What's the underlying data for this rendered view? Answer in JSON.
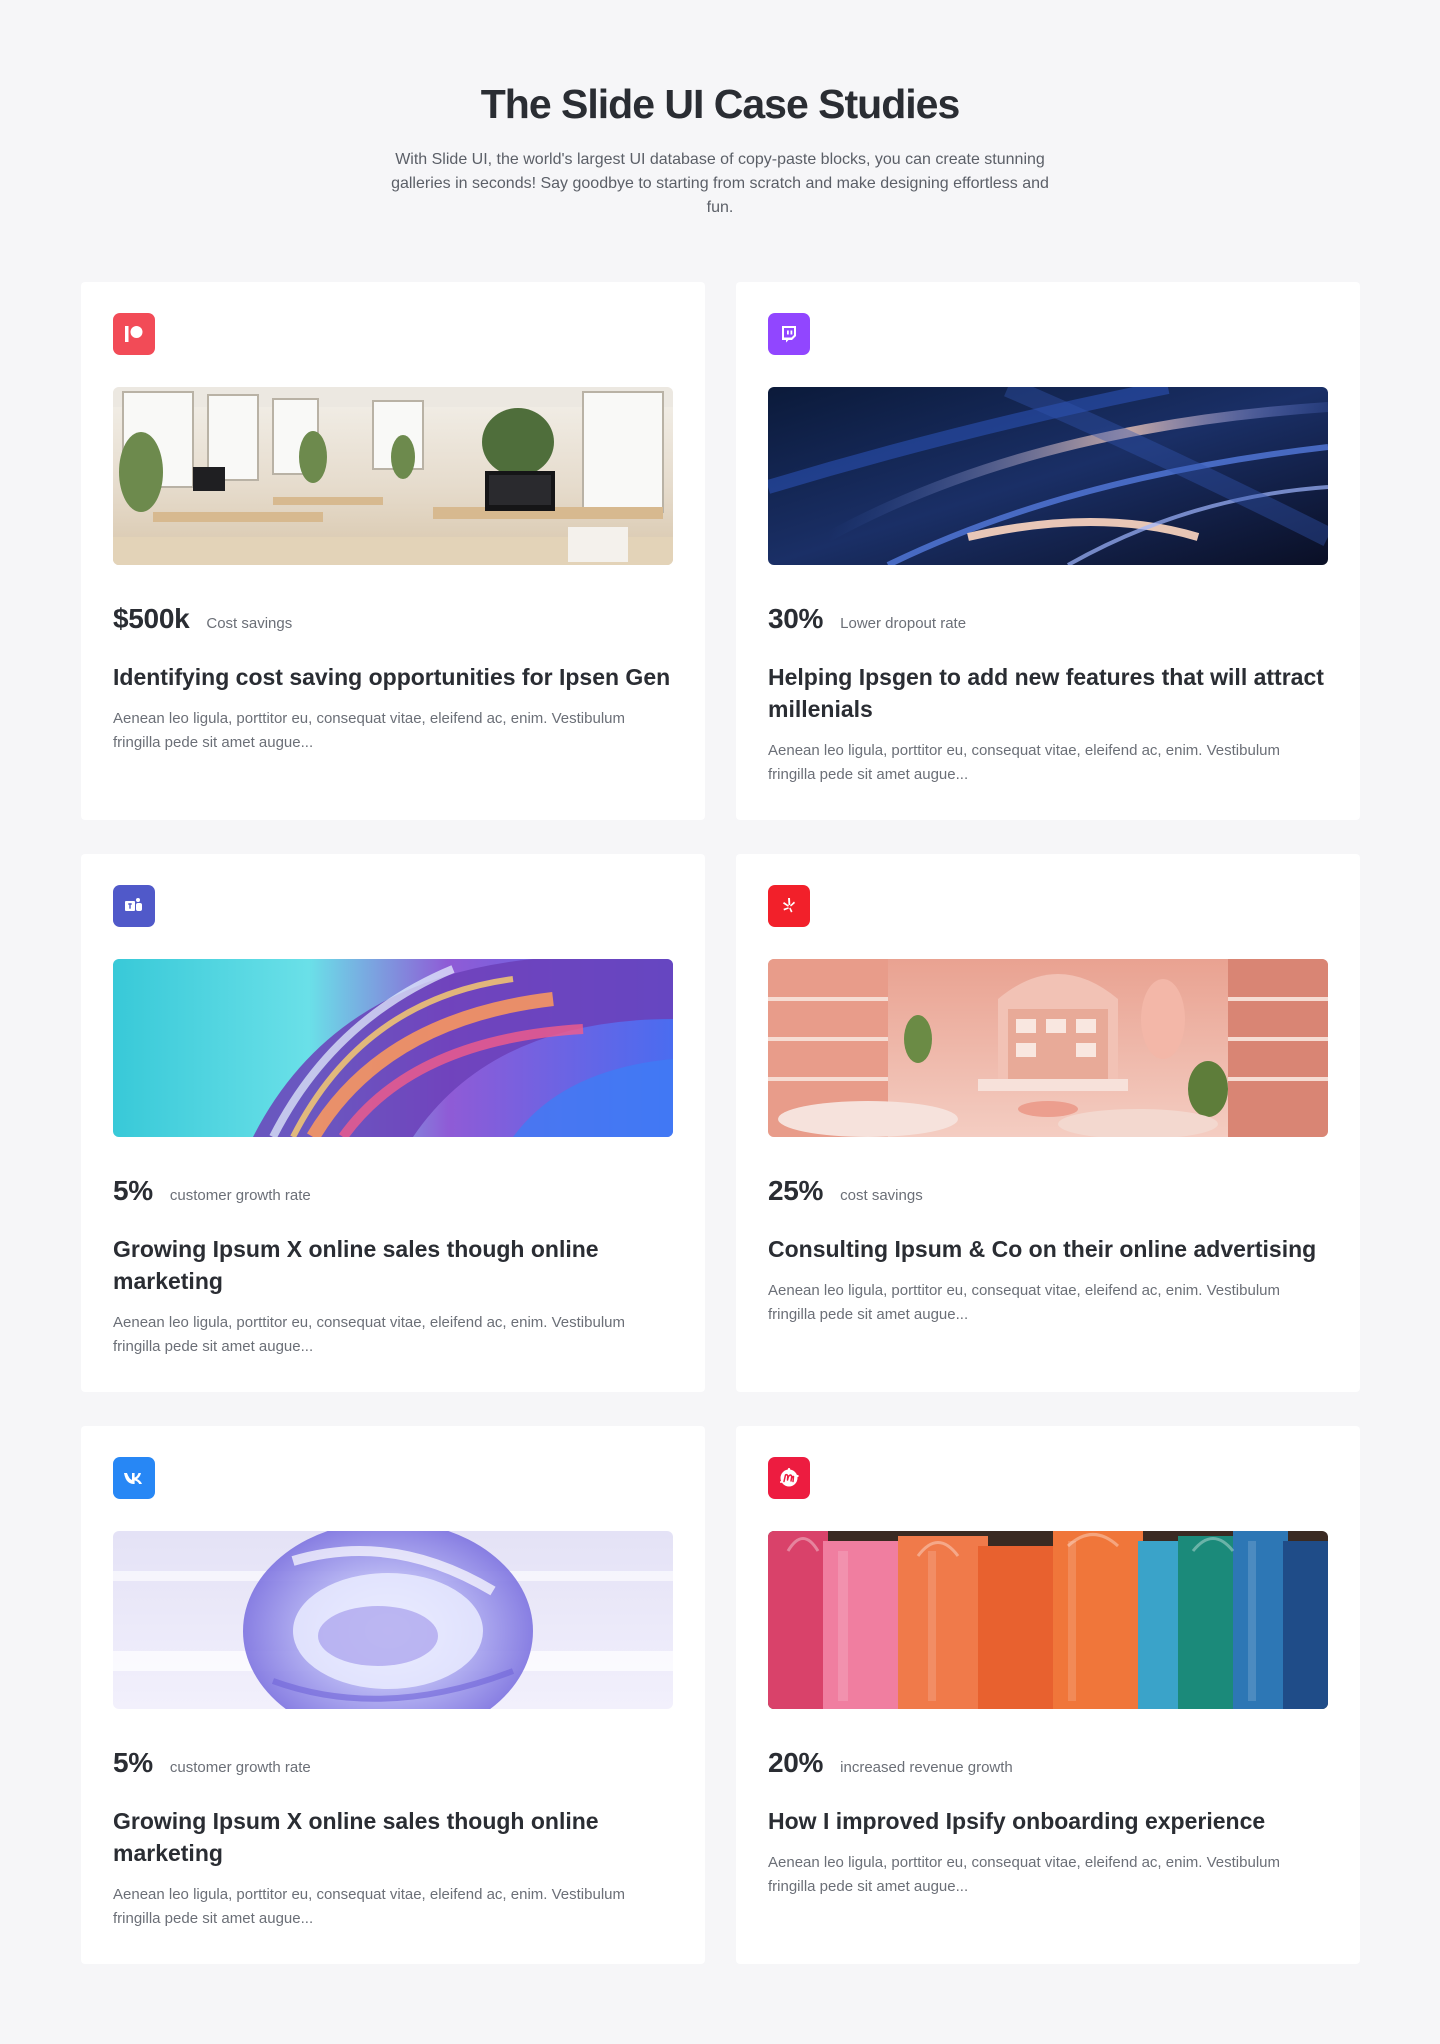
{
  "header": {
    "title": "The Slide UI Case Studies",
    "subtitle": "With Slide UI, the world's largest UI database of copy-paste blocks, you can create stunning galleries in seconds! Say goodbye to starting from scratch and make designing effortless and fun."
  },
  "cards": [
    {
      "logo_icon": "patreon-icon",
      "logo_color": "#f24b57",
      "image": "office-interior-photo",
      "metric_value": "$500k",
      "metric_label": "Cost savings",
      "title": "Identifying cost saving opportunities for Ipsen Gen",
      "description": "Aenean leo ligula, porttitor eu, consequat vitae, eleifend ac, enim. Vestibulum fringilla pede sit amet augue..."
    },
    {
      "logo_icon": "twitch-icon",
      "logo_color": "#9146ff",
      "image": "abstract-blue-streaks",
      "metric_value": "30%",
      "metric_label": "Lower dropout rate",
      "title": "Helping Ipsgen to add new features that will attract millenials",
      "description": "Aenean leo ligula, porttitor eu, consequat vitae, eleifend ac, enim. Vestibulum fringilla pede sit amet augue..."
    },
    {
      "logo_icon": "microsoft-teams-icon",
      "logo_color": "#5059c9",
      "image": "abstract-iridescent-swirl",
      "metric_value": "5%",
      "metric_label": "customer growth rate",
      "title": "Growing Ipsum X online sales though online marketing",
      "description": "Aenean leo ligula, porttitor eu, consequat vitae, eleifend ac, enim. Vestibulum fringilla pede sit amet augue..."
    },
    {
      "logo_icon": "yelp-icon",
      "logo_color": "#f2202a",
      "image": "pink-store-interior",
      "metric_value": "25%",
      "metric_label": "cost savings",
      "title": "Consulting Ipsum & Co on their online advertising",
      "description": "Aenean leo ligula, porttitor eu, consequat vitae, eleifend ac, enim. Vestibulum fringilla pede sit amet augue..."
    },
    {
      "logo_icon": "vk-icon",
      "logo_color": "#2787f5",
      "image": "abstract-glass-loop",
      "metric_value": "5%",
      "metric_label": "customer growth rate",
      "title": "Growing Ipsum X online sales though online marketing",
      "description": "Aenean leo ligula, porttitor eu, consequat vitae, eleifend ac, enim. Vestibulum fringilla pede sit amet augue..."
    },
    {
      "logo_icon": "meetup-icon",
      "logo_color": "#ed1c40",
      "image": "colorful-shopping-bags",
      "metric_value": "20%",
      "metric_label": "increased revenue growth",
      "title": "How I improved Ipsify onboarding experience",
      "description": "Aenean leo ligula, porttitor eu, consequat vitae, eleifend ac, enim. Vestibulum fringilla pede sit amet augue..."
    }
  ]
}
